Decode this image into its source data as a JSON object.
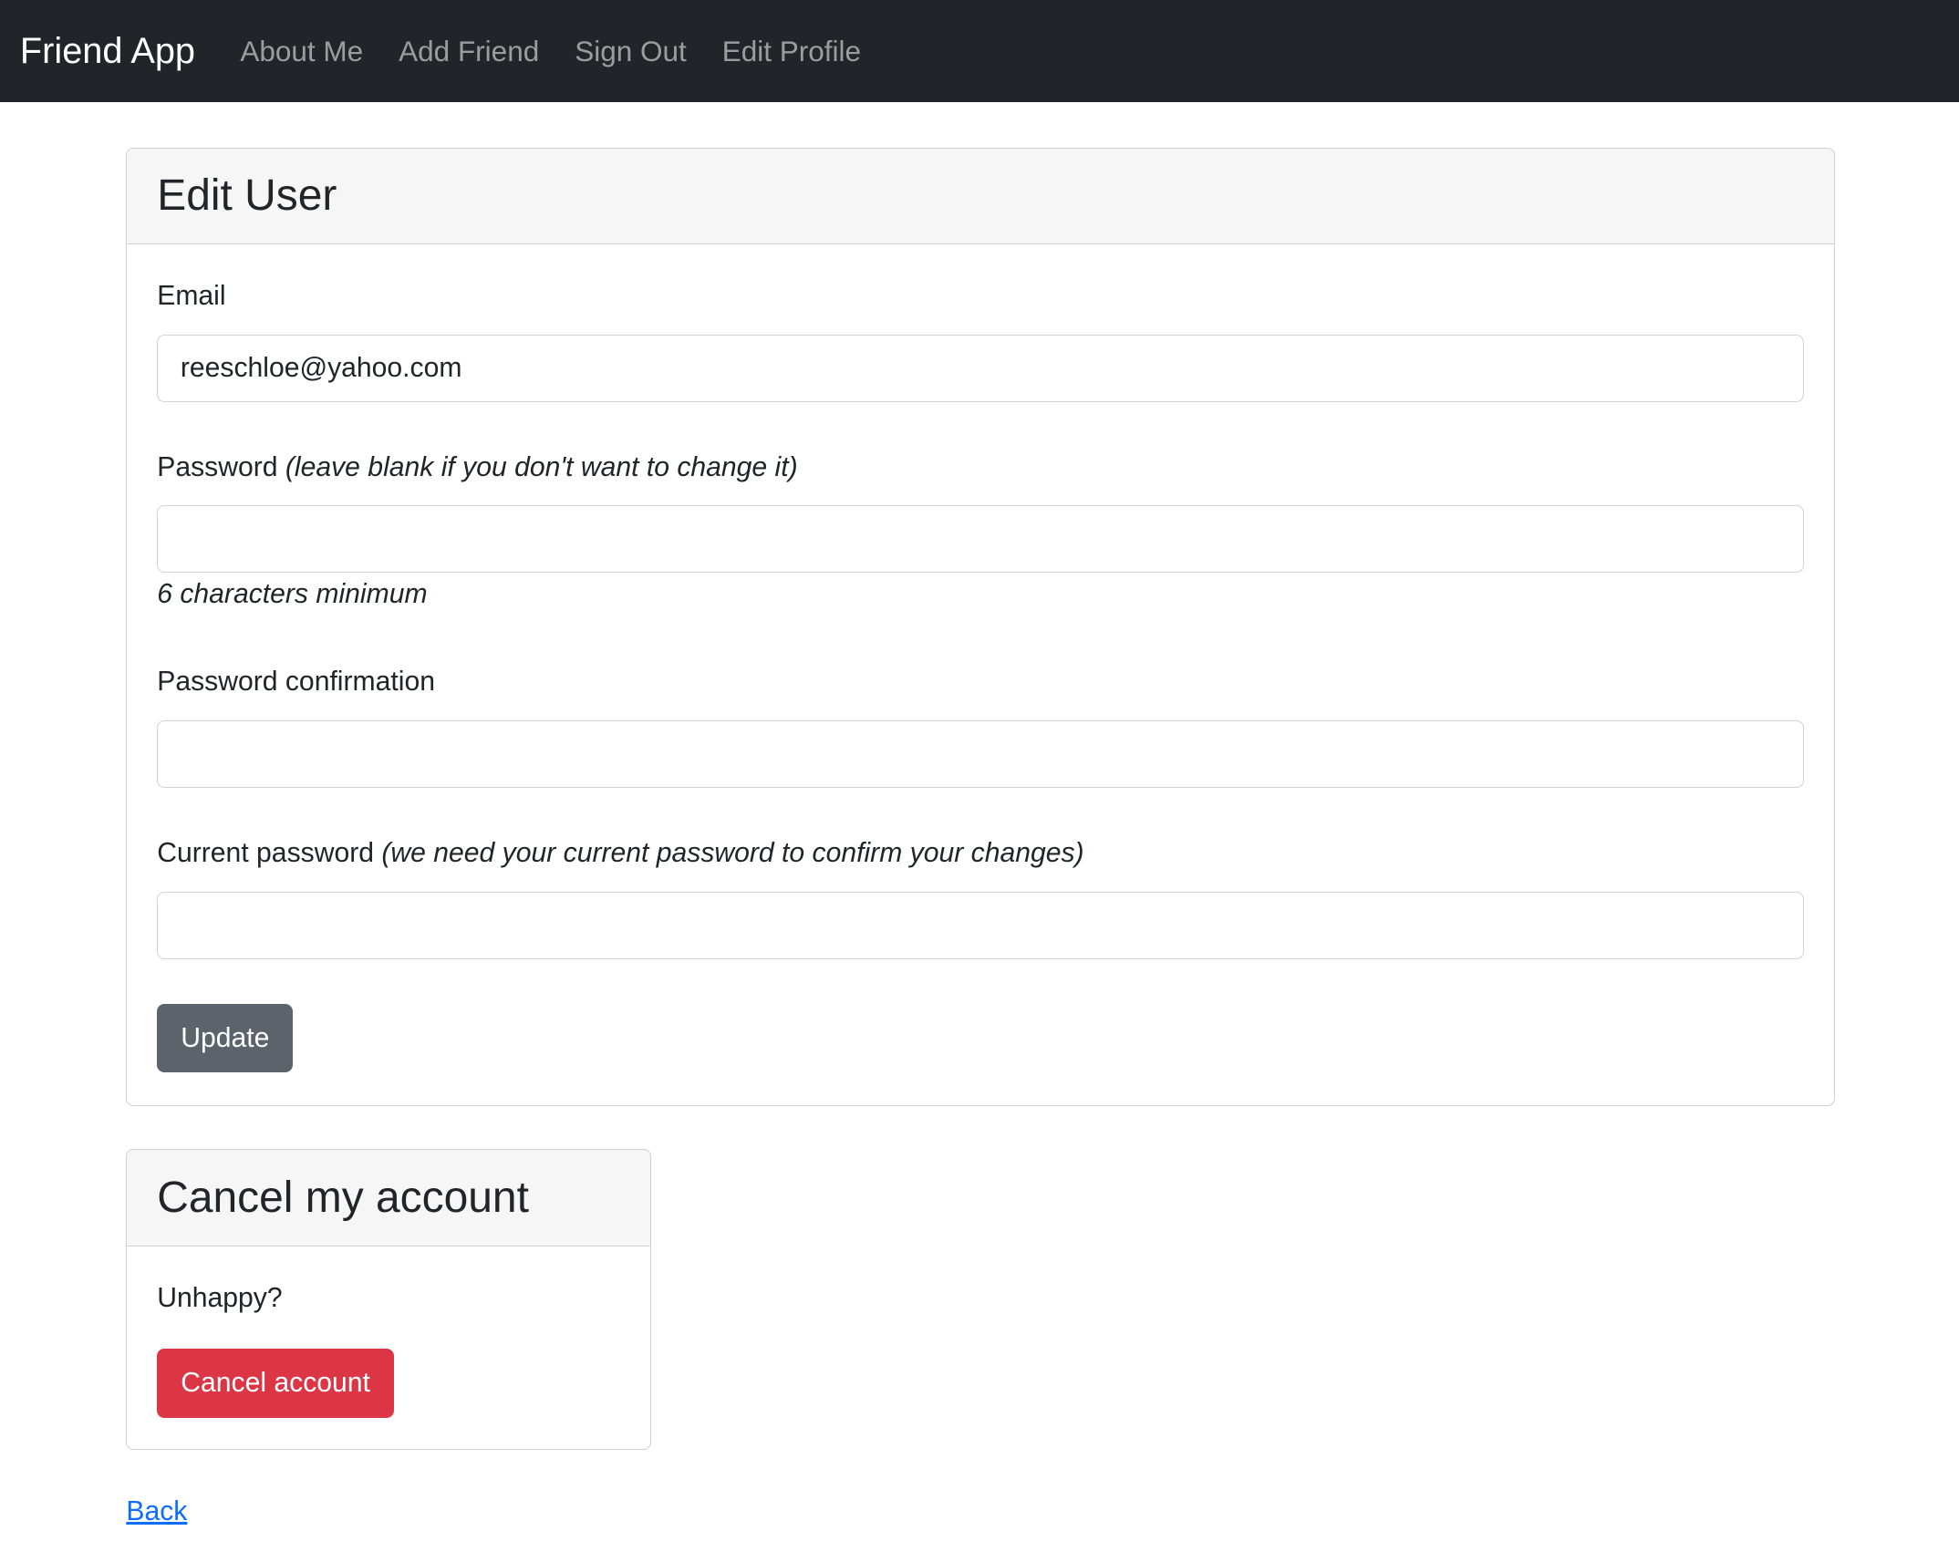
{
  "navbar": {
    "brand": "Friend App",
    "links": [
      "About Me",
      "Add Friend",
      "Sign Out",
      "Edit Profile"
    ]
  },
  "edit_card": {
    "title": "Edit User",
    "email_label": "Email",
    "email_value": "reeschloe@yahoo.com",
    "password_label": "Password",
    "password_note": "(leave blank if you don't want to change it)",
    "password_hint": "6 characters minimum",
    "confirmation_label": "Password confirmation",
    "current_label": "Current password",
    "current_note": "(we need your current password to confirm your changes)",
    "update_label": "Update",
    "update_color": "#5c636a"
  },
  "cancel_card": {
    "title": "Cancel my account",
    "text": "Unhappy?",
    "button_label": "Cancel account",
    "button_color": "#dc3545"
  },
  "back_link": "Back"
}
